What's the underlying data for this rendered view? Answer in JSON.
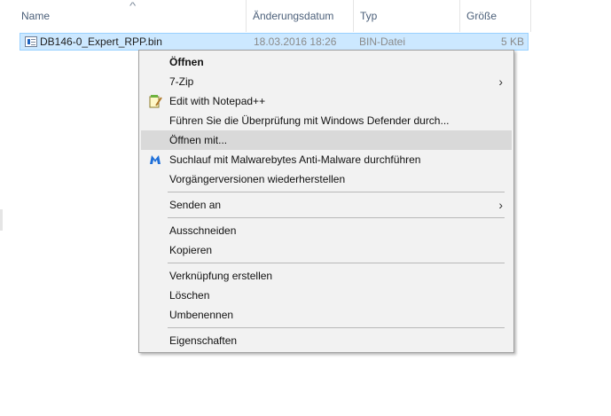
{
  "header": {
    "name": "Name",
    "date": "Änderungsdatum",
    "type": "Typ",
    "size": "Größe"
  },
  "file": {
    "name": "DB146-0_Expert_RPP.bin",
    "date": "18.03.2016 18:26",
    "type": "BIN-Datei",
    "size": "5 KB"
  },
  "menu": {
    "items": [
      {
        "label": "Öffnen"
      },
      {
        "label": "7-Zip"
      },
      {
        "label": "Edit with Notepad++",
        "icon": "notepad-icon"
      },
      {
        "label": "Führen Sie die Überprüfung mit Windows Defender durch..."
      },
      {
        "label": "Öffnen mit..."
      },
      {
        "label": "Suchlauf mit Malwarebytes Anti-Malware durchführen",
        "icon": "malwarebytes-icon"
      },
      {
        "label": "Vorgängerversionen wiederherstellen"
      },
      {
        "label": "Senden an"
      },
      {
        "label": "Ausschneiden"
      },
      {
        "label": "Kopieren"
      },
      {
        "label": "Verknüpfung erstellen"
      },
      {
        "label": "Löschen"
      },
      {
        "label": "Umbenennen"
      },
      {
        "label": "Eigenschaften"
      }
    ],
    "highlight_color": "#d9d9d9",
    "background": "#f2f2f2"
  },
  "colors": {
    "selection": "#cce8ff",
    "selection_border": "#99d1ff",
    "header_text": "#4c607a"
  }
}
